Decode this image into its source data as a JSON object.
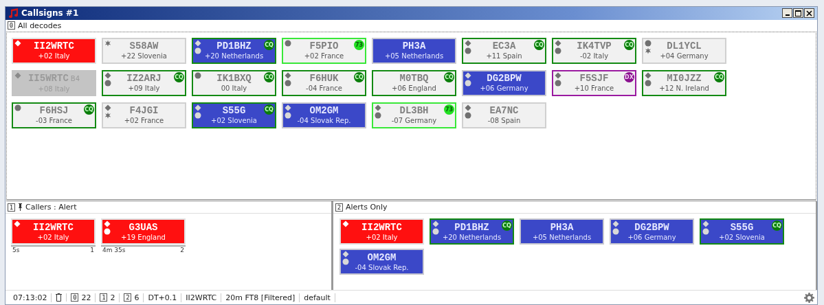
{
  "window": {
    "title": "Callsigns #1"
  },
  "all_decodes": {
    "key": "0",
    "title": "All decodes",
    "tiles": [
      {
        "call": "II2WRTC",
        "info": "+02 Italy",
        "kind": "alert",
        "marks": [
          {
            "kind": "diamond"
          }
        ]
      },
      {
        "call": "S58AW",
        "info": "+22 Slovenia",
        "kind": "plain",
        "marks": [
          {
            "kind": "star"
          }
        ]
      },
      {
        "call": "PD1BHZ",
        "info": "+20 Netherlands",
        "kind": "blue",
        "marks": [
          {
            "kind": "diamond"
          },
          {
            "kind": "dot"
          }
        ],
        "badge": {
          "kind": "cq",
          "label": "CQ"
        }
      },
      {
        "call": "F5PIO",
        "info": "+02 France",
        "kind": "plain",
        "marks": [
          {
            "kind": "dot"
          }
        ],
        "badge": {
          "kind": "final",
          "label": "73"
        }
      },
      {
        "call": "PH3A",
        "info": "+05 Netherlands",
        "kind": "blue"
      },
      {
        "call": "EC3A",
        "info": "+11 Spain",
        "kind": "plain",
        "marks": [
          {
            "kind": "diamond"
          },
          {
            "kind": "dot"
          }
        ],
        "badge": {
          "kind": "cq",
          "label": "CQ"
        }
      },
      {
        "call": "IK4TVP",
        "info": "-02 Italy",
        "kind": "plain",
        "marks": [
          {
            "kind": "diamond"
          },
          {
            "kind": "dot"
          }
        ],
        "badge": {
          "kind": "cq",
          "label": "CQ"
        }
      },
      {
        "call": "DL1YCL",
        "info": "+04 Germany",
        "kind": "plain",
        "marks": [
          {
            "kind": "dot"
          },
          {
            "kind": "star"
          }
        ]
      },
      {
        "call": "II5WRTC",
        "suffix": "B4",
        "info": "+08 Italy",
        "kind": "dim",
        "marks": [
          {
            "kind": "diamond"
          }
        ]
      },
      {
        "call": "IZ2ARJ",
        "info": "+09 Italy",
        "kind": "plain",
        "marks": [
          {
            "kind": "diamond"
          },
          {
            "kind": "dot"
          }
        ],
        "badge": {
          "kind": "cq",
          "label": "CQ"
        }
      },
      {
        "call": "IK1BXQ",
        "info": "00 Italy",
        "kind": "plain",
        "marks": [
          {
            "kind": "dot"
          }
        ],
        "badge": {
          "kind": "cq",
          "label": "CQ"
        }
      },
      {
        "call": "F6HUK",
        "info": "-04 France",
        "kind": "plain",
        "marks": [
          {
            "kind": "diamond"
          },
          {
            "kind": "dot"
          }
        ],
        "badge": {
          "kind": "cq",
          "label": "CQ"
        }
      },
      {
        "call": "M0TBQ",
        "info": "+06 England",
        "kind": "plain",
        "badge": {
          "kind": "cq",
          "label": "CQ"
        }
      },
      {
        "call": "DG2BPW",
        "info": "+06 Germany",
        "kind": "blue",
        "marks": [
          {
            "kind": "diamond"
          },
          {
            "kind": "dot"
          }
        ]
      },
      {
        "call": "F5SJF",
        "info": "+10 France",
        "kind": "plain",
        "marks": [
          {
            "kind": "diamond"
          },
          {
            "kind": "dot"
          }
        ],
        "badge": {
          "kind": "dx",
          "label": "DX"
        }
      },
      {
        "call": "MI0JZZ",
        "info": "+12 N. Ireland",
        "kind": "plain",
        "marks": [
          {
            "kind": "diamond"
          },
          {
            "kind": "dot"
          }
        ],
        "badge": {
          "kind": "cq",
          "label": "CQ"
        }
      },
      {
        "call": "F6HSJ",
        "info": "-03 France",
        "kind": "plain",
        "marks": [
          {
            "kind": "dot"
          }
        ],
        "badge": {
          "kind": "cq",
          "label": "CQ"
        }
      },
      {
        "call": "F4JGI",
        "info": "+02 France",
        "kind": "plain",
        "marks": [
          {
            "kind": "diamond"
          },
          {
            "kind": "star"
          }
        ]
      },
      {
        "call": "S55G",
        "info": "+02 Slovenia",
        "kind": "blue",
        "marks": [
          {
            "kind": "diamond"
          },
          {
            "kind": "dot"
          }
        ],
        "badge": {
          "kind": "cq",
          "label": "CQ"
        }
      },
      {
        "call": "OM2GM",
        "info": "-04 Slovak Rep.",
        "kind": "blue",
        "marks": [
          {
            "kind": "diamond"
          },
          {
            "kind": "dot"
          }
        ]
      },
      {
        "call": "DL3BH",
        "info": "-07 Germany",
        "kind": "plain",
        "marks": [
          {
            "kind": "diamond"
          },
          {
            "kind": "dot"
          }
        ],
        "badge": {
          "kind": "final",
          "label": "73"
        }
      },
      {
        "call": "EA7NC",
        "info": "-08 Spain",
        "kind": "plain",
        "marks": [
          {
            "kind": "diamond"
          },
          {
            "kind": "dot"
          }
        ]
      }
    ]
  },
  "callers": {
    "key": "1",
    "pinned": true,
    "title": "Callers : Alert",
    "tiles": [
      {
        "call": "II2WRTC",
        "info": "+02 Italy",
        "kind": "alert",
        "marks": [
          {
            "kind": "diamond"
          }
        ],
        "age": "5s",
        "count": "1"
      },
      {
        "call": "G3UAS",
        "info": "+19 England",
        "kind": "alert",
        "marks": [
          {
            "kind": "diamond"
          },
          {
            "kind": "dot"
          }
        ],
        "age": "4m 35s",
        "count": "2"
      }
    ]
  },
  "alerts": {
    "key": "2",
    "title": "Alerts Only",
    "tiles": [
      {
        "call": "II2WRTC",
        "info": "+02 Italy",
        "kind": "alert",
        "marks": [
          {
            "kind": "diamond"
          }
        ]
      },
      {
        "call": "PD1BHZ",
        "info": "+20 Netherlands",
        "kind": "blue",
        "marks": [
          {
            "kind": "diamond"
          },
          {
            "kind": "dot"
          }
        ],
        "badge": {
          "kind": "cq",
          "label": "CQ"
        }
      },
      {
        "call": "PH3A",
        "info": "+05 Netherlands",
        "kind": "blue"
      },
      {
        "call": "DG2BPW",
        "info": "+06 Germany",
        "kind": "blue",
        "marks": [
          {
            "kind": "diamond"
          },
          {
            "kind": "dot"
          }
        ]
      },
      {
        "call": "S55G",
        "info": "+02 Slovenia",
        "kind": "blue",
        "marks": [
          {
            "kind": "diamond"
          },
          {
            "kind": "dot"
          }
        ],
        "badge": {
          "kind": "cq",
          "label": "CQ"
        }
      },
      {
        "call": "OM2GM",
        "info": "-04 Slovak Rep.",
        "kind": "blue",
        "marks": [
          {
            "kind": "diamond"
          },
          {
            "kind": "dot"
          }
        ]
      }
    ]
  },
  "status_bar": [
    {
      "kind": "text",
      "text": "07:13:02"
    },
    {
      "kind": "trash"
    },
    {
      "kind": "count",
      "key": "0",
      "text": "22"
    },
    {
      "kind": "count",
      "key": "1",
      "text": "2"
    },
    {
      "kind": "count",
      "key": "2",
      "text": "6"
    },
    {
      "kind": "text",
      "text": "DT+0.1"
    },
    {
      "kind": "text",
      "text": "II2WRTC"
    },
    {
      "kind": "text",
      "text": "20m FT8 [Filtered]"
    },
    {
      "kind": "text",
      "text": "default"
    }
  ]
}
